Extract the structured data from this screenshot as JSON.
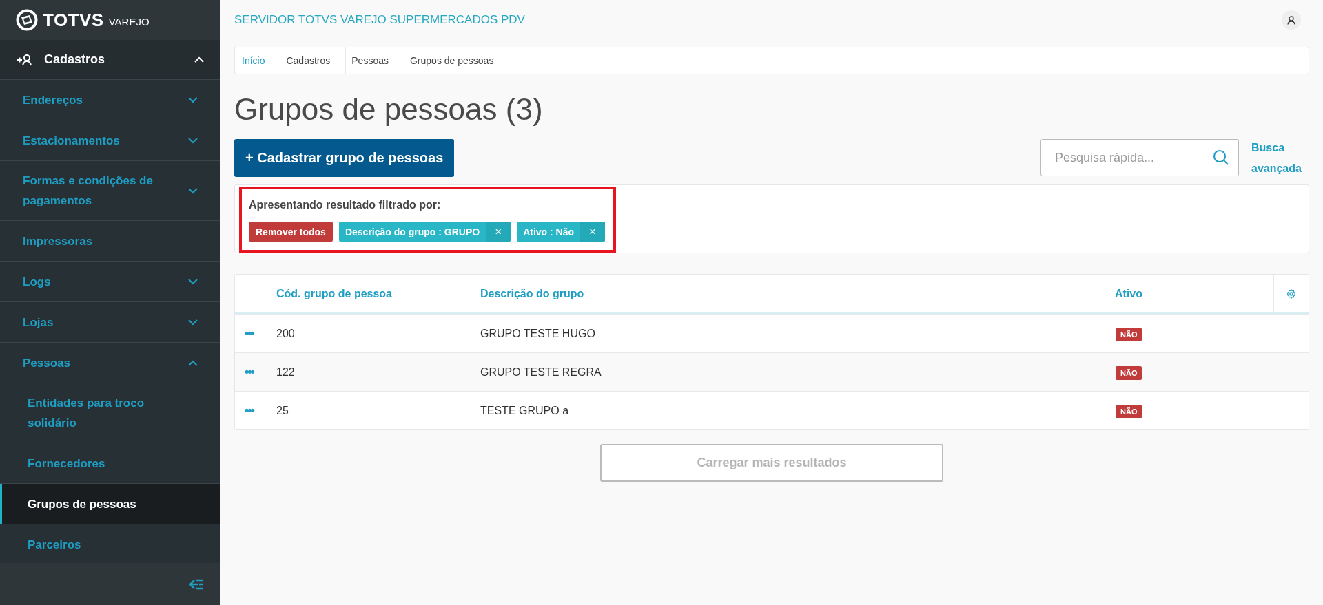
{
  "logo": {
    "brand": "TOTVS",
    "product": "VAREJO"
  },
  "sidebar": {
    "section": {
      "label": "Cadastros",
      "expanded": true,
      "children": [
        {
          "label": "Endereços",
          "kind": "group",
          "expanded": false,
          "selected": false
        },
        {
          "label": "Estacionamentos",
          "kind": "group",
          "expanded": false,
          "selected": false
        },
        {
          "label": "Formas e condições de pagamentos",
          "kind": "group",
          "expanded": false,
          "selected": false
        },
        {
          "label": "Impressoras",
          "kind": "link",
          "selected": false
        },
        {
          "label": "Logs",
          "kind": "group",
          "expanded": false,
          "selected": false
        },
        {
          "label": "Lojas",
          "kind": "group",
          "expanded": false,
          "selected": false
        },
        {
          "label": "Pessoas",
          "kind": "group",
          "expanded": true,
          "selected": false,
          "children": [
            {
              "label": "Entidades para troco solidário",
              "selected": false
            },
            {
              "label": "Fornecedores",
              "selected": false
            },
            {
              "label": "Grupos de pessoas",
              "selected": true
            },
            {
              "label": "Parceiros",
              "selected": false
            }
          ]
        }
      ]
    }
  },
  "header": {
    "title": "SERVIDOR TOTVS VAREJO SUPERMERCADOS PDV"
  },
  "breadcrumb": [
    {
      "label": "Início",
      "kind": "link"
    },
    {
      "label": "Cadastros",
      "kind": "text"
    },
    {
      "label": "Pessoas",
      "kind": "text"
    },
    {
      "label": "Grupos de pessoas",
      "kind": "text"
    }
  ],
  "page_title": "Grupos de pessoas (3)",
  "create_button": "+ Cadastrar grupo de pessoas",
  "search": {
    "placeholder": "Pesquisa rápida..."
  },
  "advanced_search": "Busca avançada",
  "filters": {
    "heading": "Apresentando resultado filtrado por:",
    "remove_all": "Remover todos",
    "highlighted": true,
    "tags": [
      {
        "label": "Descrição do grupo : GRUPO",
        "remove": "×"
      },
      {
        "label": "Ativo : Não",
        "remove": "×"
      }
    ]
  },
  "table": {
    "columns": [
      "Cód. grupo de pessoa",
      "Descrição do grupo",
      "Ativo"
    ],
    "rows": [
      {
        "actions": "•••",
        "code": "200",
        "description": "GRUPO TESTE HUGO",
        "active": "NÃO"
      },
      {
        "actions": "•••",
        "code": "122",
        "description": "GRUPO TESTE REGRA",
        "active": "NÃO"
      },
      {
        "actions": "•••",
        "code": "25",
        "description": "TESTE GRUPO a",
        "active": "NÃO"
      }
    ]
  },
  "load_more": {
    "label": "Carregar mais resultados",
    "disabled": true
  }
}
